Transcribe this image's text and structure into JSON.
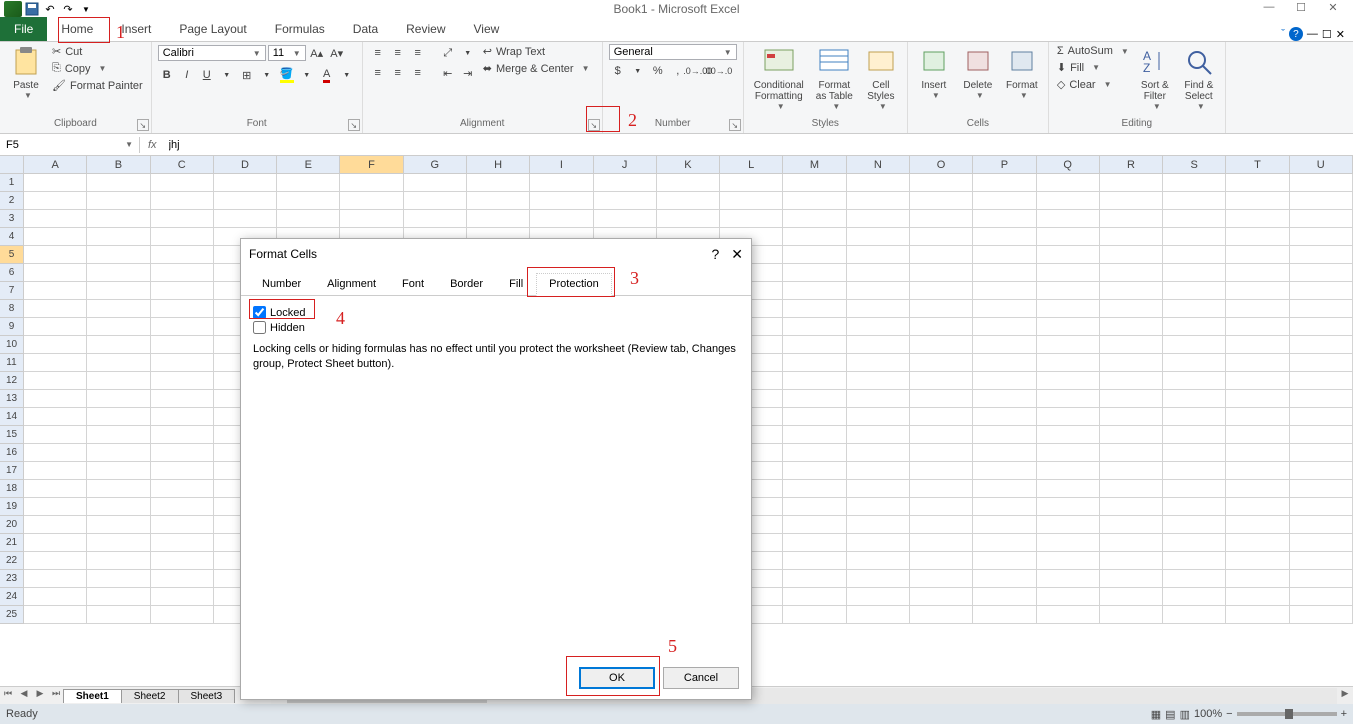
{
  "title": "Book1 - Microsoft Excel",
  "tabs": {
    "file": "File",
    "list": [
      "Home",
      "Insert",
      "Page Layout",
      "Formulas",
      "Data",
      "Review",
      "View"
    ],
    "active": "Home"
  },
  "ribbon": {
    "clipboard": {
      "label": "Clipboard",
      "paste": "Paste",
      "cut": "Cut",
      "copy": "Copy",
      "format_painter": "Format Painter"
    },
    "font": {
      "label": "Font",
      "name": "Calibri",
      "size": "11"
    },
    "alignment": {
      "label": "Alignment",
      "wrap": "Wrap Text",
      "merge": "Merge & Center"
    },
    "number": {
      "label": "Number",
      "format": "General"
    },
    "styles": {
      "label": "Styles",
      "cond": "Conditional\nFormatting",
      "table": "Format\nas Table",
      "cell": "Cell\nStyles"
    },
    "cells": {
      "label": "Cells",
      "insert": "Insert",
      "delete": "Delete",
      "format": "Format"
    },
    "editing": {
      "label": "Editing",
      "autosum": "AutoSum",
      "fill": "Fill",
      "clear": "Clear",
      "sort": "Sort &\nFilter",
      "find": "Find &\nSelect"
    }
  },
  "name_box": "F5",
  "formula": "jhj",
  "columns": [
    "A",
    "B",
    "C",
    "D",
    "E",
    "F",
    "G",
    "H",
    "I",
    "J",
    "K",
    "L",
    "M",
    "N",
    "O",
    "P",
    "Q",
    "R",
    "S",
    "T",
    "U"
  ],
  "rows_count": 25,
  "selected_col": "F",
  "selected_row": 5,
  "sheets": [
    "Sheet1",
    "Sheet2",
    "Sheet3"
  ],
  "active_sheet": "Sheet1",
  "status": "Ready",
  "zoom": "100%",
  "dialog": {
    "title": "Format Cells",
    "tabs": [
      "Number",
      "Alignment",
      "Font",
      "Border",
      "Fill",
      "Protection"
    ],
    "active_tab": "Protection",
    "locked_label": "Locked",
    "locked_checked": true,
    "hidden_label": "Hidden",
    "hidden_checked": false,
    "note": "Locking cells or hiding formulas has no effect until you protect the worksheet (Review tab, Changes group, Protect Sheet button).",
    "ok": "OK",
    "cancel": "Cancel"
  },
  "annotations": {
    "n1": "1",
    "n2": "2",
    "n3": "3",
    "n4": "4",
    "n5": "5"
  }
}
